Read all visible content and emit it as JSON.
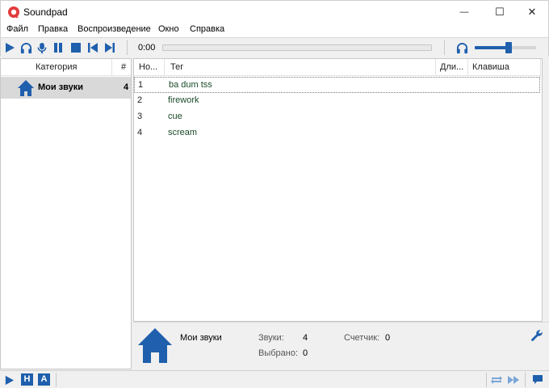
{
  "window": {
    "title": "Soundpad",
    "minimize_glyph": "—",
    "maximize_glyph": "☐",
    "close_glyph": "✕"
  },
  "menu": [
    "Файл",
    "Правка",
    "Воспроизведение",
    "Окно",
    "Справка"
  ],
  "player": {
    "time": "0:00",
    "progress": 0,
    "volume": 0.55
  },
  "categories": {
    "header_label": "Категория",
    "header_count": "#",
    "items": [
      {
        "name": "Мои звуки",
        "count": "4",
        "icon": "home-icon"
      }
    ]
  },
  "sound_list": {
    "columns": [
      "Но...",
      "Тег",
      "Дли...",
      "Клавиша"
    ],
    "rows": [
      {
        "num": "1",
        "tag": "ba dum tss"
      },
      {
        "num": "2",
        "tag": "firework"
      },
      {
        "num": "3",
        "tag": "cue"
      },
      {
        "num": "4",
        "tag": "scream"
      }
    ]
  },
  "info": {
    "category_name": "Мои звуки",
    "sounds_label": "Звуки:",
    "sounds_value": "4",
    "selected_label": "Выбрано:",
    "selected_value": "0",
    "counter_label": "Счетчик:",
    "counter_value": "0"
  },
  "statusbar": {
    "h_label": "H",
    "a_label": "A"
  },
  "colors": {
    "accent": "#1f5fad",
    "logo": "#e23b3b",
    "tag_text": "#1a4a2a"
  }
}
